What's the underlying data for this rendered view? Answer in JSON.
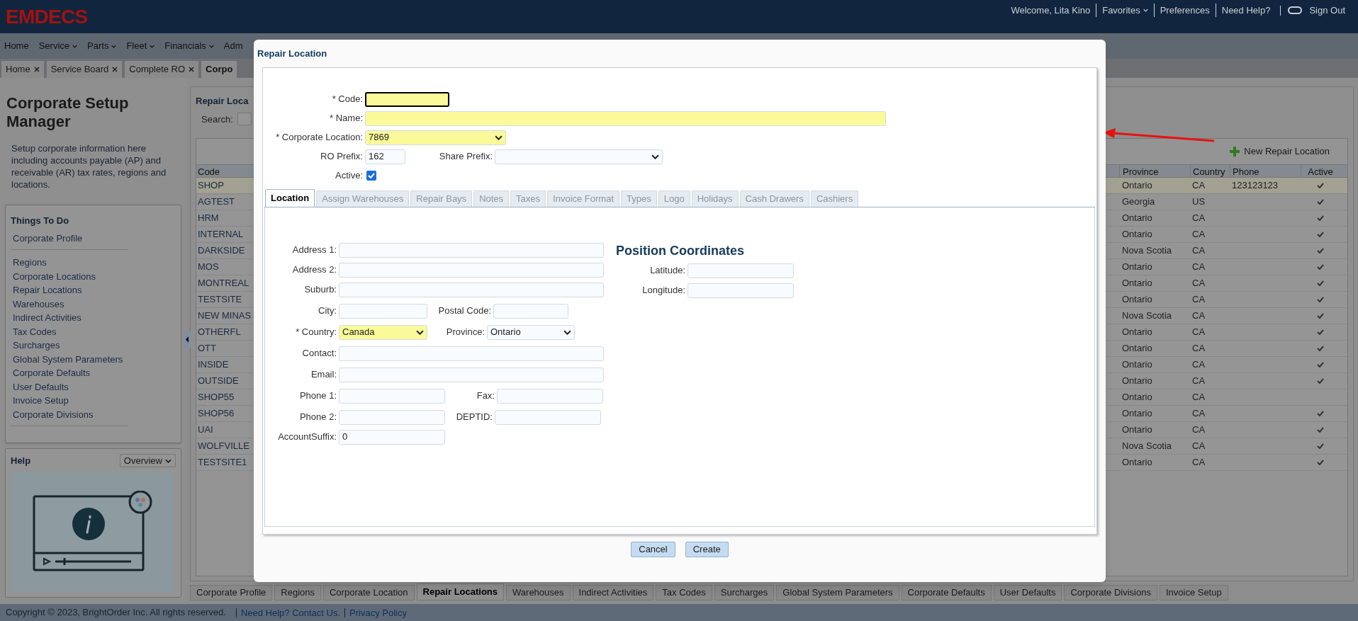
{
  "header": {
    "logo": "EMDECS",
    "links": [
      "Welcome, Lita Kino",
      "Favorites",
      "Preferences",
      "Need Help?",
      "Sign Out"
    ]
  },
  "nav": [
    {
      "label": "Home",
      "dropdown": false
    },
    {
      "label": "Service",
      "dropdown": true
    },
    {
      "label": "Parts",
      "dropdown": true
    },
    {
      "label": "Fleet",
      "dropdown": true
    },
    {
      "label": "Financials",
      "dropdown": true
    },
    {
      "label": "Adm",
      "dropdown": false
    }
  ],
  "page_tabs": [
    {
      "label": "Home",
      "closable": true,
      "selected": false
    },
    {
      "label": "Service Board",
      "closable": true,
      "selected": false
    },
    {
      "label": "Complete RO",
      "closable": true,
      "selected": false
    },
    {
      "label": "Corpo",
      "closable": false,
      "selected": true
    }
  ],
  "sidebar": {
    "title": "Corporate Setup Manager",
    "description": "Setup corporate information here including accounts payable (AP) and receivable (AR) tax rates, regions and locations.",
    "things_to_do": {
      "title": "Things To Do",
      "groups": [
        [
          "Corporate Profile"
        ],
        [
          "Regions",
          "Corporate Locations",
          "Repair Locations",
          "Warehouses",
          "Indirect Activities",
          "Tax Codes",
          "Surcharges",
          "Global System Parameters",
          "Corporate Defaults",
          "User Defaults",
          "Invoice Setup",
          "Corporate Divisions"
        ]
      ]
    },
    "help": {
      "title": "Help",
      "dropdown": "Overview"
    }
  },
  "main": {
    "title": "Repair Loca",
    "search_label": "Search:",
    "new_button": "New Repair Location",
    "columns": [
      "Code",
      "Province",
      "Country",
      "Phone",
      "Active"
    ],
    "rows": [
      {
        "code": "SHOP",
        "province": "Ontario",
        "country": "CA",
        "phone": "123123123",
        "active": true,
        "selected": true
      },
      {
        "code": "AGTEST",
        "province": "Georgia",
        "country": "US",
        "active": true,
        "selected": false
      },
      {
        "code": "HRM",
        "province": "Ontario",
        "country": "CA",
        "active": true,
        "selected": false
      },
      {
        "code": "INTERNAL",
        "province": "Ontario",
        "country": "CA",
        "active": true,
        "selected": false
      },
      {
        "code": "DARKSIDE",
        "province": "Nova Scotia",
        "country": "CA",
        "active": true,
        "selected": false
      },
      {
        "code": "MOS",
        "province": "Ontario",
        "country": "CA",
        "active": true,
        "selected": false
      },
      {
        "code": "MONTREAL",
        "province": "Ontario",
        "country": "CA",
        "active": true,
        "selected": false
      },
      {
        "code": "TESTSITE",
        "province": "Ontario",
        "country": "CA",
        "active": true,
        "selected": false
      },
      {
        "code": "NEW MINAS",
        "province": "Nova Scotia",
        "country": "CA",
        "active": true,
        "selected": false
      },
      {
        "code": "OTHERFL",
        "province": "Ontario",
        "country": "CA",
        "active": true,
        "selected": false
      },
      {
        "code": "OTT",
        "province": "Ontario",
        "country": "CA",
        "active": true,
        "selected": false
      },
      {
        "code": "INSIDE",
        "province": "Ontario",
        "country": "CA",
        "active": true,
        "selected": false
      },
      {
        "code": "OUTSIDE",
        "province": "Ontario",
        "country": "CA",
        "active": true,
        "selected": false
      },
      {
        "code": "SHOP55",
        "province": "Ontario",
        "country": "CA",
        "active": false,
        "selected": false
      },
      {
        "code": "SHOP56",
        "province": "Ontario",
        "country": "CA",
        "active": true,
        "selected": false
      },
      {
        "code": "UAI",
        "province": "Ontario",
        "country": "CA",
        "active": true,
        "selected": false
      },
      {
        "code": "WOLFVILLE",
        "province": "Nova Scotia",
        "country": "CA",
        "active": true,
        "selected": false
      },
      {
        "code": "TESTSITE1",
        "province": "Ontario",
        "country": "CA",
        "active": true,
        "selected": false
      }
    ]
  },
  "bottom_tabs": [
    {
      "label": "Corporate Profile",
      "selected": false
    },
    {
      "label": "Regions",
      "selected": false
    },
    {
      "label": "Corporate Location",
      "selected": false
    },
    {
      "label": "Repair Locations",
      "selected": true
    },
    {
      "label": "Warehouses",
      "selected": false
    },
    {
      "label": "Indirect Activities",
      "selected": false
    },
    {
      "label": "Tax Codes",
      "selected": false
    },
    {
      "label": "Surcharges",
      "selected": false
    },
    {
      "label": "Global System Parameters",
      "selected": false
    },
    {
      "label": "Corporate Defaults",
      "selected": false
    },
    {
      "label": "User Defaults",
      "selected": false
    },
    {
      "label": "Corporate Divisions",
      "selected": false
    },
    {
      "label": "Invoice Setup",
      "selected": false
    }
  ],
  "footer": {
    "copyright": "Copyright © 2023, BrightOrder Inc. All rights reserved.",
    "links": [
      "Need Help? Contact Us.",
      "Privacy Policy"
    ]
  },
  "modal": {
    "title": "Repair Location",
    "code": {
      "label": "* Code:",
      "highlighted": true,
      "focused": true
    },
    "name": {
      "label": "* Name:",
      "highlighted": true,
      "focused": false
    },
    "corporate_location": {
      "label": "* Corporate Location:",
      "value": "7869",
      "highlighted": true
    },
    "ro_prefix": {
      "label": "RO Prefix:",
      "value": "162"
    },
    "share_prefix": {
      "label": "Share Prefix:"
    },
    "active": {
      "label": "Active:",
      "checked": true
    },
    "tabs": [
      {
        "label": "Location",
        "selected": true
      },
      {
        "label": "Assign Warehouses",
        "selected": false
      },
      {
        "label": "Repair Bays",
        "selected": false
      },
      {
        "label": "Notes",
        "selected": false
      },
      {
        "label": "Taxes",
        "selected": false
      },
      {
        "label": "Invoice Format",
        "selected": false
      },
      {
        "label": "Types",
        "selected": false
      },
      {
        "label": "Logo",
        "selected": false
      },
      {
        "label": "Holidays",
        "selected": false
      },
      {
        "label": "Cash Drawers",
        "selected": false
      },
      {
        "label": "Cashiers",
        "selected": false
      }
    ],
    "location": {
      "address_1": {
        "label": "Address 1:"
      },
      "address_2": {
        "label": "Address 2:"
      },
      "suburb": {
        "label": "Suburb:"
      },
      "city": {
        "label": "City:"
      },
      "postal_code": {
        "label": "Postal Code:"
      },
      "country": {
        "label": "* Country:",
        "value": "Canada",
        "highlighted": true
      },
      "province": {
        "label": "Province:",
        "value": "Ontario",
        "highlighted": false
      },
      "contact": {
        "label": "Contact:"
      },
      "email": {
        "label": "Email:"
      },
      "phone_1": {
        "label": "Phone 1:"
      },
      "fax": {
        "label": "Fax:"
      },
      "phone_2": {
        "label": "Phone 2:"
      },
      "deptid": {
        "label": "DEPTID:"
      },
      "account_suffix": {
        "label": "AccountSuffix:",
        "value": "0"
      }
    },
    "coordinates": {
      "title": "Position Coordinates",
      "latitude": {
        "label": "Latitude:"
      },
      "longitude": {
        "label": "Longitude:"
      }
    },
    "buttons": [
      "Cancel",
      "Create"
    ]
  }
}
